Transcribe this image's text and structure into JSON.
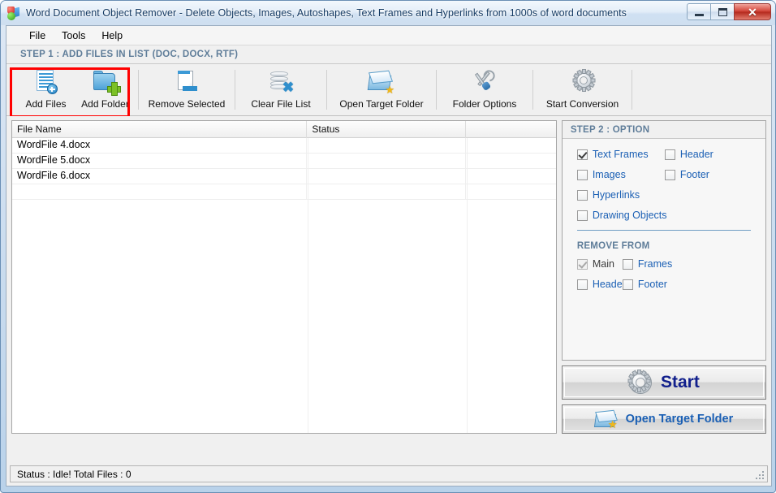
{
  "window": {
    "title": "Word Document Object Remover - Delete Objects, Images, Autoshapes, Text Frames and Hyperlinks from 1000s of word documents",
    "icon": "app-icon",
    "controls": {
      "minimize": "minimize-button",
      "maximize": "maximize-button",
      "close_glyph": "✕"
    }
  },
  "menu": {
    "items": [
      {
        "label": "File"
      },
      {
        "label": "Tools"
      },
      {
        "label": "Help"
      }
    ]
  },
  "step1": {
    "header": "STEP 1 : ADD FILES IN LIST (DOC, DOCX, RTF)"
  },
  "toolbar": {
    "buttons": [
      {
        "label": "Add Files",
        "icon": "add-files-icon"
      },
      {
        "label": "Add Folder",
        "icon": "add-folder-icon"
      },
      {
        "label": "Remove Selected",
        "icon": "remove-selected-icon"
      },
      {
        "label": "Clear File List",
        "icon": "clear-file-list-icon"
      },
      {
        "label": "Open Target Folder",
        "icon": "open-target-folder-icon"
      },
      {
        "label": "Folder Options",
        "icon": "folder-options-icon"
      },
      {
        "label": "Start Conversion",
        "icon": "start-conversion-icon"
      }
    ],
    "highlight_color": "#ff0000"
  },
  "file_grid": {
    "columns": [
      "File Name",
      "Status",
      ""
    ],
    "rows": [
      {
        "file_name": "WordFile 4.docx",
        "status": "",
        "extra": ""
      },
      {
        "file_name": "WordFile 5.docx",
        "status": "",
        "extra": ""
      },
      {
        "file_name": "WordFile 6.docx",
        "status": "",
        "extra": ""
      }
    ]
  },
  "step2": {
    "header": "STEP 2 : OPTION",
    "options": [
      {
        "label": "Text Frames",
        "checked": true,
        "disabled": false
      },
      {
        "label": "Header",
        "checked": false,
        "disabled": false
      },
      {
        "label": "Images",
        "checked": false,
        "disabled": false
      },
      {
        "label": "Footer",
        "checked": false,
        "disabled": false
      },
      {
        "label": "Hyperlinks",
        "checked": false,
        "disabled": false
      },
      {
        "label": "Drawing Objects",
        "checked": false,
        "disabled": false
      }
    ],
    "remove_from_title": "REMOVE FROM",
    "remove_from": [
      {
        "label": "Main",
        "checked": true,
        "disabled": true
      },
      {
        "label": "Frames",
        "checked": false,
        "disabled": false
      },
      {
        "label": "Header",
        "checked": false,
        "disabled": false
      },
      {
        "label": "Footer",
        "checked": false,
        "disabled": false
      }
    ],
    "start_button": {
      "label": "Start",
      "icon": "gear-icon"
    },
    "open_target_button": {
      "label": "Open Target Folder",
      "icon": "open-folder-icon"
    }
  },
  "statusbar": {
    "text": "Status  :  Idle!  Total Files : 0"
  },
  "colors": {
    "accent_blue": "#1a5fb4",
    "header_blue_grey": "#5f7d99",
    "highlight_red": "#ff0000",
    "start_navy": "#111f8c"
  }
}
